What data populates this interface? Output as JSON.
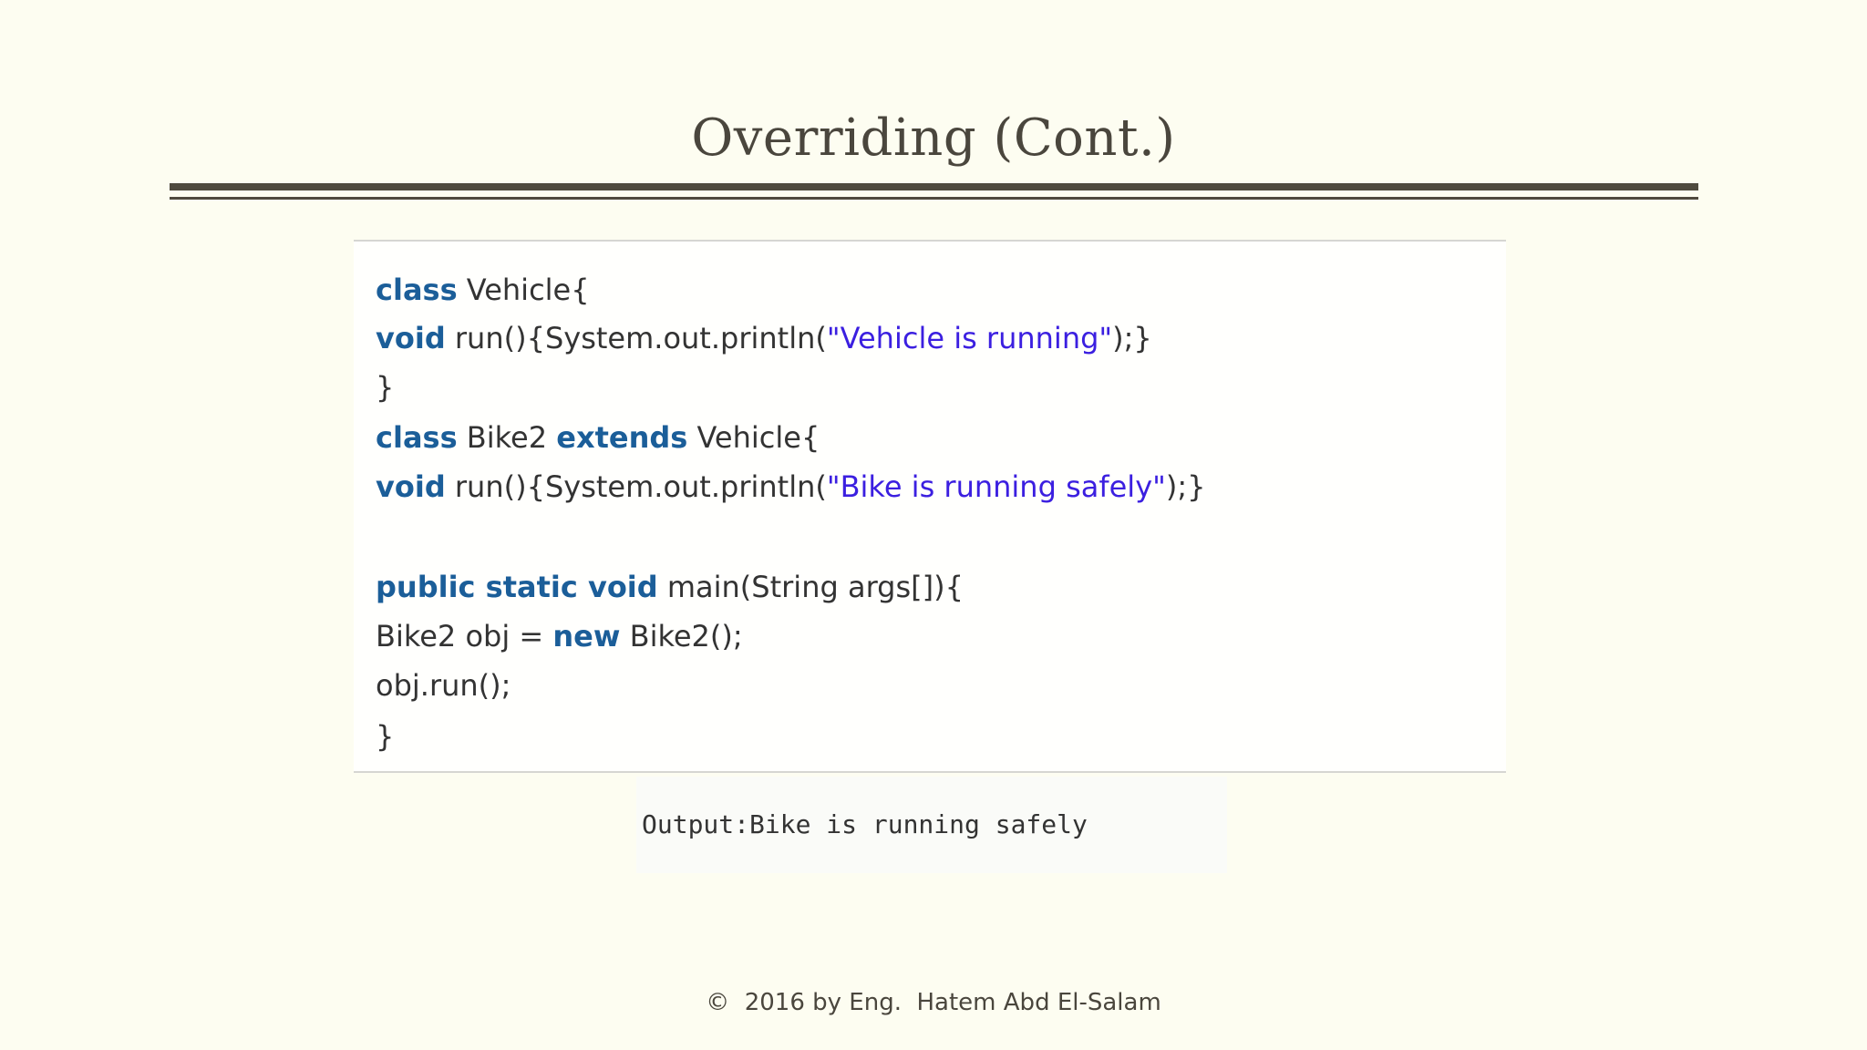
{
  "slide": {
    "title": "Overriding (Cont.)",
    "footer": "©  2016 by Eng.  Hatem Abd El-Salam"
  },
  "code": {
    "line1": {
      "kw1": "class",
      "rest": " Vehicle{"
    },
    "line2": {
      "kw1": "void",
      "pre": " run(){System.out.println(",
      "str": "\"Vehicle is running\"",
      "post": ");}"
    },
    "line3": {
      "text": "}"
    },
    "line4": {
      "kw1": "class",
      "mid": " Bike2 ",
      "kw2": "extends",
      "rest": " Vehicle{"
    },
    "line5": {
      "kw1": "void",
      "pre": " run(){System.out.println(",
      "str": "\"Bike is running safely\"",
      "post": ");}"
    },
    "line7": {
      "kw1": "public static void",
      "rest": " main(String args[]){"
    },
    "line8": {
      "pre": "Bike2 obj = ",
      "kw1": "new",
      "rest": " Bike2();"
    },
    "line9": {
      "text": "obj.run();"
    },
    "line10": {
      "text": "}"
    }
  },
  "output": {
    "text": "Output:Bike is running safely"
  },
  "colors": {
    "background": "#fdfdf1",
    "keyword": "#1b5e99",
    "string": "#3b1fe0",
    "rule": "#4f4a3f"
  }
}
